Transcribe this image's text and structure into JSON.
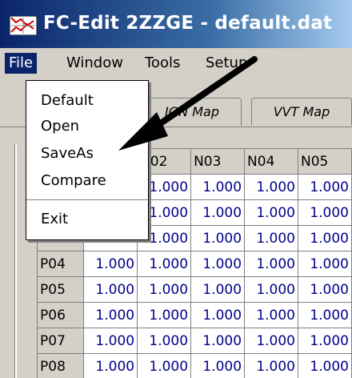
{
  "window": {
    "title": "FC-Edit 2ZZGE - default.dat"
  },
  "menubar": {
    "items": [
      {
        "label": "File"
      },
      {
        "label": "Window"
      },
      {
        "label": "Tools"
      },
      {
        "label": "Setup"
      }
    ]
  },
  "tabs": [
    {
      "label": "IGN Map"
    },
    {
      "label": "VVT Map"
    }
  ],
  "file_menu": {
    "items": [
      {
        "label": "Default"
      },
      {
        "label": "Open"
      },
      {
        "label": "SaveAs"
      },
      {
        "label": "Compare"
      },
      {
        "label": "Exit"
      }
    ]
  },
  "grid": {
    "col_headers": [
      "N02",
      "N03",
      "N04",
      "N05"
    ],
    "rows": [
      {
        "label": "",
        "values": [
          "1.000",
          "1.000",
          "1.000",
          "1.000"
        ]
      },
      {
        "label": "",
        "values": [
          "1.000",
          "1.000",
          "1.000",
          "1.000"
        ]
      },
      {
        "label": "",
        "values": [
          "1.000",
          "1.000",
          "1.000",
          "1.000"
        ]
      },
      {
        "label": "P04",
        "values": [
          "1.000",
          "1.000",
          "1.000",
          "1.000",
          "1.000"
        ]
      },
      {
        "label": "P05",
        "values": [
          "1.000",
          "1.000",
          "1.000",
          "1.000",
          "1.000"
        ]
      },
      {
        "label": "P06",
        "values": [
          "1.000",
          "1.000",
          "1.000",
          "1.000",
          "1.000"
        ]
      },
      {
        "label": "P07",
        "values": [
          "1.000",
          "1.000",
          "1.000",
          "1.000",
          "1.000"
        ]
      },
      {
        "label": "P08",
        "values": [
          "1.000",
          "1.000",
          "1.000",
          "1.000",
          "1.000"
        ]
      }
    ]
  },
  "colors": {
    "title_bar": "#0a246a",
    "menu_highlight": "#0a246a",
    "cell_text": "#00008b"
  }
}
